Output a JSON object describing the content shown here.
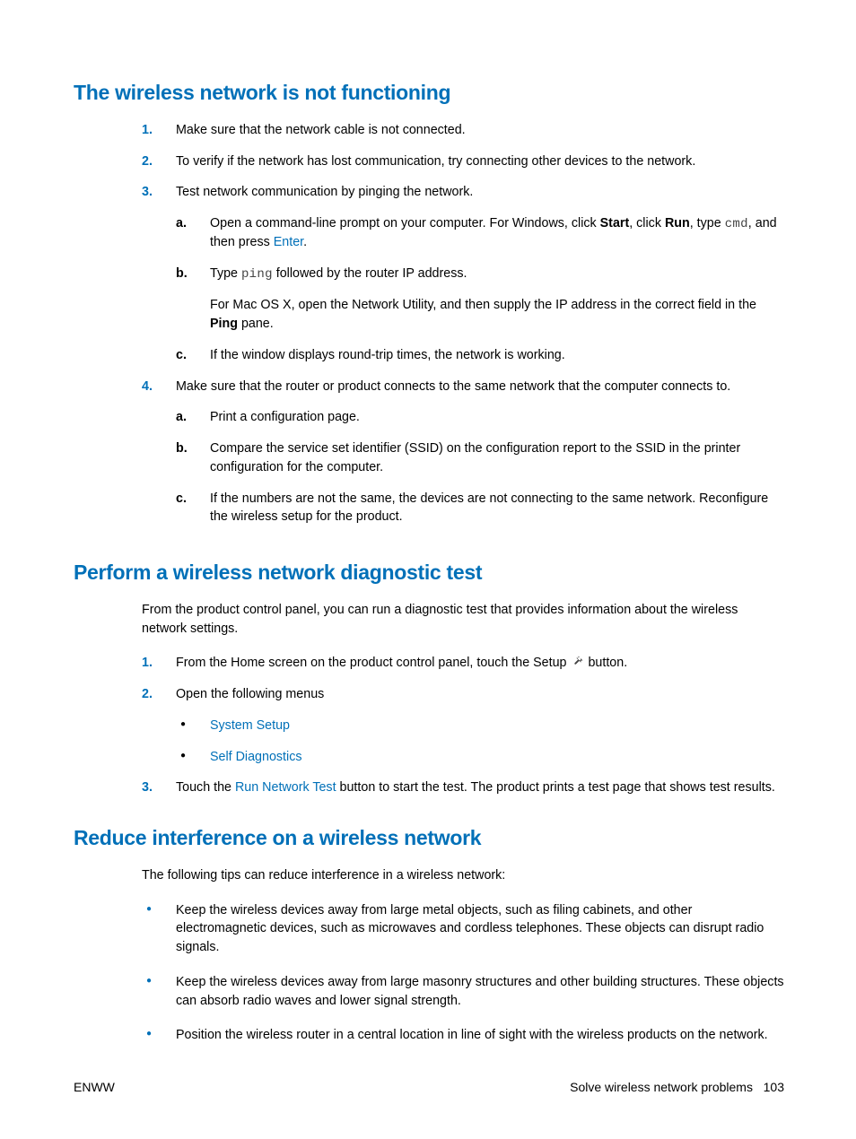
{
  "section1": {
    "heading": "The wireless network is not functioning",
    "items": [
      {
        "text": "Make sure that the network cable is not connected."
      },
      {
        "text": "To verify if the network has lost communication, try connecting other devices to the network."
      },
      {
        "text": "Test network communication by pinging the network.",
        "sub": [
          {
            "prefix": "Open a command-line prompt on your computer. For Windows, click ",
            "b1": "Start",
            "mid1": ", click ",
            "b2": "Run",
            "mid2": ", type ",
            "code": "cmd",
            "mid3": ", and then press ",
            "link": "Enter",
            "suffix": "."
          },
          {
            "prefix": "Type ",
            "code": "ping",
            "mid": " followed by the router IP address.",
            "para_prefix": "For Mac OS X, open the Network Utility, and then supply the IP address in the correct field in the ",
            "para_b": "Ping",
            "para_suffix": " pane."
          },
          {
            "text": "If the window displays round-trip times, the network is working."
          }
        ]
      },
      {
        "text": "Make sure that the router or product connects to the same network that the computer connects to.",
        "sub": [
          {
            "text": "Print a configuration page."
          },
          {
            "text": "Compare the service set identifier (SSID) on the configuration report to the SSID in the printer configuration for the computer."
          },
          {
            "text": "If the numbers are not the same, the devices are not connecting to the same network. Reconfigure the wireless setup for the product."
          }
        ]
      }
    ]
  },
  "section2": {
    "heading": "Perform a wireless network diagnostic test",
    "intro": "From the product control panel, you can run a diagnostic test that provides information about the wireless network settings.",
    "items": [
      {
        "prefix": "From the Home screen on the product control panel, touch the Setup ",
        "suffix": " button."
      },
      {
        "text": "Open the following menus",
        "bullets": [
          "System Setup",
          "Self Diagnostics"
        ]
      },
      {
        "prefix": "Touch the ",
        "link": "Run Network Test",
        "suffix": " button to start the test. The product prints a test page that shows test results."
      }
    ]
  },
  "section3": {
    "heading": "Reduce interference on a wireless network",
    "intro": "The following tips can reduce interference in a wireless network:",
    "tips": [
      "Keep the wireless devices away from large metal objects, such as filing cabinets, and other electromagnetic devices, such as microwaves and cordless telephones. These objects can disrupt radio signals.",
      "Keep the wireless devices away from large masonry structures and other building structures. These objects can absorb radio waves and lower signal strength.",
      "Position the wireless router in a central location in line of sight with the wireless products on the network."
    ]
  },
  "footer": {
    "left": "ENWW",
    "right_text": "Solve wireless network problems",
    "page_num": "103"
  }
}
